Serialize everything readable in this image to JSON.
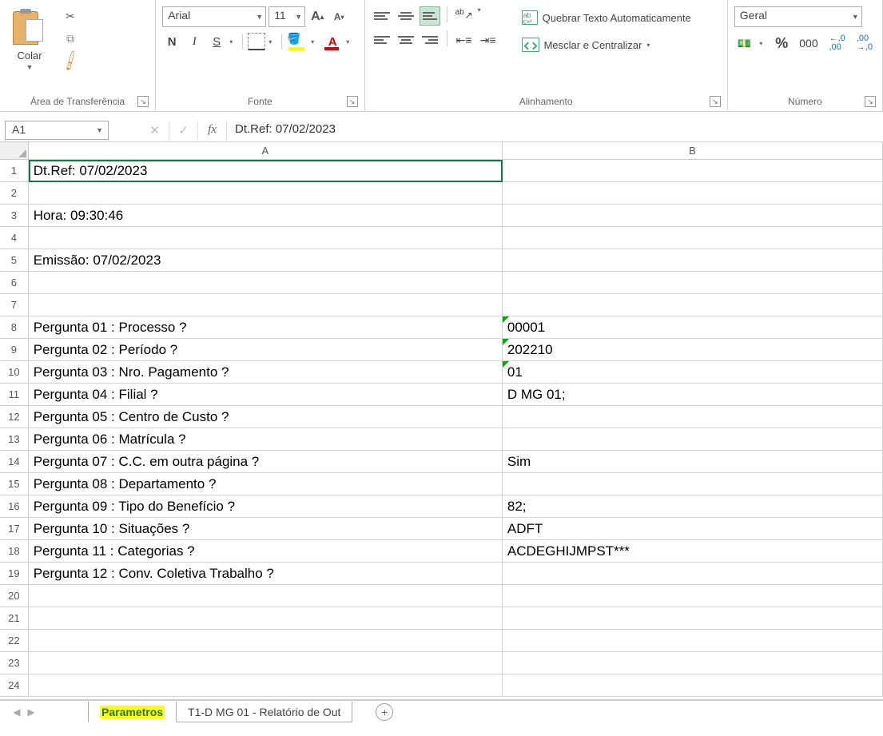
{
  "ribbon": {
    "clipboard": {
      "paste_label": "Colar",
      "group_label": "Área de Transferência"
    },
    "font": {
      "name": "Arial",
      "size": "11",
      "bold": "N",
      "italic": "I",
      "underline": "S",
      "group_label": "Fonte"
    },
    "alignment": {
      "wrap_label": "Quebrar Texto Automaticamente",
      "merge_label": "Mesclar e Centralizar",
      "group_label": "Alinhamento"
    },
    "number": {
      "format": "Geral",
      "thousands": "000",
      "dec_inc": ",0\n,00",
      "dec_dec": ",00\n,0",
      "group_label": "Número"
    }
  },
  "formula_bar": {
    "name_box": "A1",
    "fx": "fx",
    "content": "Dt.Ref: 07/02/2023"
  },
  "columns": {
    "A": "A",
    "B": "B"
  },
  "rows": [
    {
      "n": "1",
      "a": "Dt.Ref: 07/02/2023",
      "b": "",
      "sel": true
    },
    {
      "n": "2",
      "a": "",
      "b": ""
    },
    {
      "n": "3",
      "a": "Hora: 09:30:46",
      "b": ""
    },
    {
      "n": "4",
      "a": "",
      "b": ""
    },
    {
      "n": "5",
      "a": "Emissão: 07/02/2023",
      "b": ""
    },
    {
      "n": "6",
      "a": "",
      "b": ""
    },
    {
      "n": "7",
      "a": "",
      "b": ""
    },
    {
      "n": "8",
      "a": "Pergunta 01 : Processo ?",
      "b": "00001",
      "tri": true
    },
    {
      "n": "9",
      "a": "Pergunta 02 : Período ?",
      "b": "202210",
      "tri": true
    },
    {
      "n": "10",
      "a": "Pergunta 03 : Nro. Pagamento ?",
      "b": "01",
      "tri": true
    },
    {
      "n": "11",
      "a": "Pergunta 04 : Filial ?",
      "b": "D MG 01;"
    },
    {
      "n": "12",
      "a": "Pergunta 05 : Centro de Custo ?",
      "b": ""
    },
    {
      "n": "13",
      "a": "Pergunta 06 : Matrícula ?",
      "b": ""
    },
    {
      "n": "14",
      "a": "Pergunta 07 : C.C. em outra página ?",
      "b": "Sim"
    },
    {
      "n": "15",
      "a": "Pergunta 08 : Departamento ?",
      "b": ""
    },
    {
      "n": "16",
      "a": "Pergunta 09 : Tipo do Benefício ?",
      "b": "82;"
    },
    {
      "n": "17",
      "a": "Pergunta 10 : Situações ?",
      "b": " ADFT"
    },
    {
      "n": "18",
      "a": "Pergunta 11 : Categorias ?",
      "b": "ACDEGHIJMPST***"
    },
    {
      "n": "19",
      "a": "Pergunta 12 : Conv. Coletiva Trabalho ?",
      "b": ""
    },
    {
      "n": "20",
      "a": "",
      "b": ""
    },
    {
      "n": "21",
      "a": "",
      "b": ""
    },
    {
      "n": "22",
      "a": "",
      "b": ""
    },
    {
      "n": "23",
      "a": "",
      "b": ""
    },
    {
      "n": "24",
      "a": "",
      "b": ""
    }
  ],
  "sheets": {
    "tab1": "Parametros",
    "tab2": "T1-D MG 01  - Relatório de Out"
  }
}
